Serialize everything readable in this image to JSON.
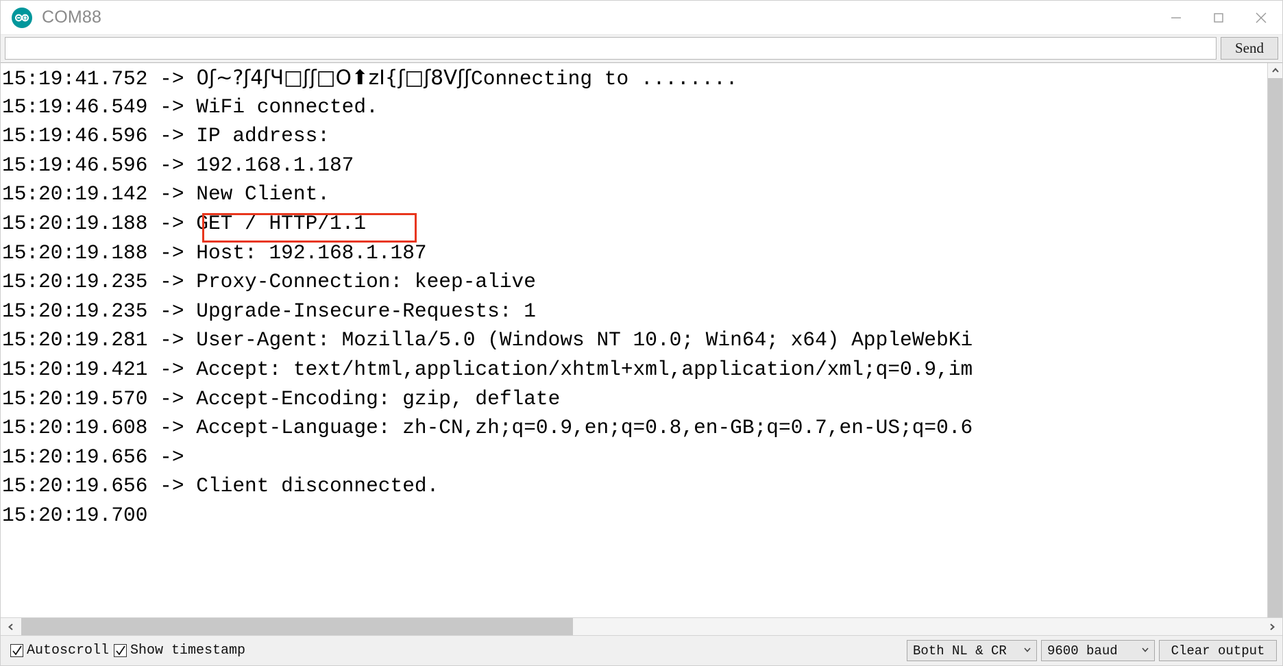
{
  "window": {
    "title": "COM88",
    "logo_icon": "arduino-infinity-logo",
    "brand_color": "#00979c",
    "controls": {
      "minimize": "minimize-icon",
      "maximize": "maximize-icon",
      "close": "close-icon"
    }
  },
  "send_row": {
    "input_value": "",
    "input_placeholder": "",
    "send_label": "Send"
  },
  "console": {
    "highlight_color": "#e8361c",
    "highlighted_text": "192.168.1.187",
    "lines": [
      {
        "timestamp": "15:19:41.752",
        "arrow": "->",
        "text": "0ʃ~?ʃ4ʃЧ□ʃʃ□O⬆zI{ʃ□ʃ8Vʃʃ",
        "suffix": "Connecting to ........",
        "garbled": true
      },
      {
        "timestamp": "15:19:46.549",
        "arrow": "->",
        "text": "WiFi connected.",
        "garbled": false
      },
      {
        "timestamp": "15:19:46.596",
        "arrow": "->",
        "text": "IP address:",
        "garbled": false
      },
      {
        "timestamp": "15:19:46.596",
        "arrow": "->",
        "text": "192.168.1.187",
        "garbled": false
      },
      {
        "timestamp": "15:20:19.142",
        "arrow": "->",
        "text": "New Client.",
        "garbled": false
      },
      {
        "timestamp": "15:20:19.188",
        "arrow": "->",
        "text": "GET / HTTP/1.1",
        "garbled": false
      },
      {
        "timestamp": "15:20:19.188",
        "arrow": "->",
        "text": "Host: 192.168.1.187",
        "garbled": false
      },
      {
        "timestamp": "15:20:19.235",
        "arrow": "->",
        "text": "Proxy-Connection: keep-alive",
        "garbled": false
      },
      {
        "timestamp": "15:20:19.235",
        "arrow": "->",
        "text": "Upgrade-Insecure-Requests: 1",
        "garbled": false
      },
      {
        "timestamp": "15:20:19.281",
        "arrow": "->",
        "text": "User-Agent: Mozilla/5.0 (Windows NT 10.0; Win64; x64) AppleWebKi",
        "garbled": false
      },
      {
        "timestamp": "15:20:19.421",
        "arrow": "->",
        "text": "Accept: text/html,application/xhtml+xml,application/xml;q=0.9,im",
        "garbled": false
      },
      {
        "timestamp": "15:20:19.570",
        "arrow": "->",
        "text": "Accept-Encoding: gzip, deflate",
        "garbled": false
      },
      {
        "timestamp": "15:20:19.608",
        "arrow": "->",
        "text": "Accept-Language: zh-CN,zh;q=0.9,en;q=0.8,en-GB;q=0.7,en-US;q=0.6",
        "garbled": false
      },
      {
        "timestamp": "15:20:19.656",
        "arrow": "->",
        "text": "",
        "garbled": false
      },
      {
        "timestamp": "15:20:19.656",
        "arrow": "->",
        "text": "Client disconnected.",
        "garbled": false
      },
      {
        "timestamp": "15:20:19.700",
        "arrow": "",
        "text": "",
        "garbled": false
      }
    ]
  },
  "status_bar": {
    "autoscroll_label": "Autoscroll",
    "autoscroll_checked": true,
    "show_timestamp_label": "Show timestamp",
    "show_timestamp_checked": true,
    "line_ending": "Both NL & CR",
    "baud_rate": "9600 baud",
    "clear_label": "Clear output"
  }
}
